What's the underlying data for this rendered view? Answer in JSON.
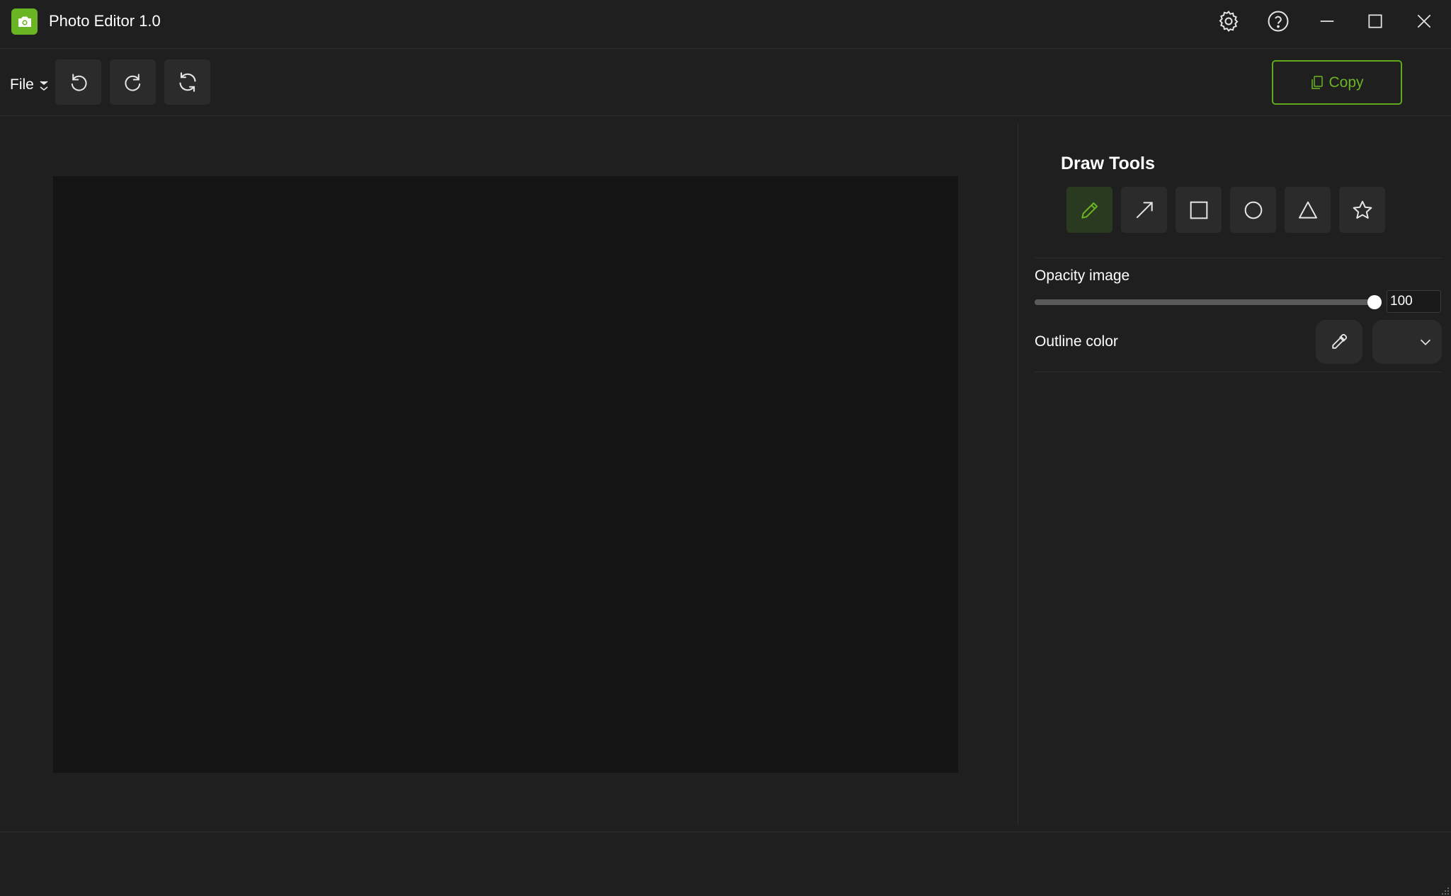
{
  "window": {
    "title": "Photo Editor 1.0",
    "icons": [
      "camera-icon",
      "settings-icon",
      "help-icon",
      "minimize-icon",
      "maximize-icon",
      "close-icon"
    ]
  },
  "toolbar": {
    "file_label": "File",
    "copy_label": "Copy",
    "buttons": [
      "undo-icon",
      "redo-icon",
      "refresh-icon"
    ]
  },
  "panel": {
    "title": "Draw Tools",
    "tools": [
      {
        "name": "pencil",
        "active": true
      },
      {
        "name": "arrow",
        "active": false
      },
      {
        "name": "rectangle",
        "active": false
      },
      {
        "name": "circle",
        "active": false
      },
      {
        "name": "triangle",
        "active": false
      },
      {
        "name": "star",
        "active": false
      }
    ],
    "opacity_label": "Opacity image",
    "opacity_value": "100",
    "opacity_fraction": 1.0,
    "outline_label": "Outline color"
  },
  "colors": {
    "accent": "#6ab523",
    "background": "#1f1f1f",
    "canvas": "#141414",
    "button": "#2b2b2b"
  }
}
